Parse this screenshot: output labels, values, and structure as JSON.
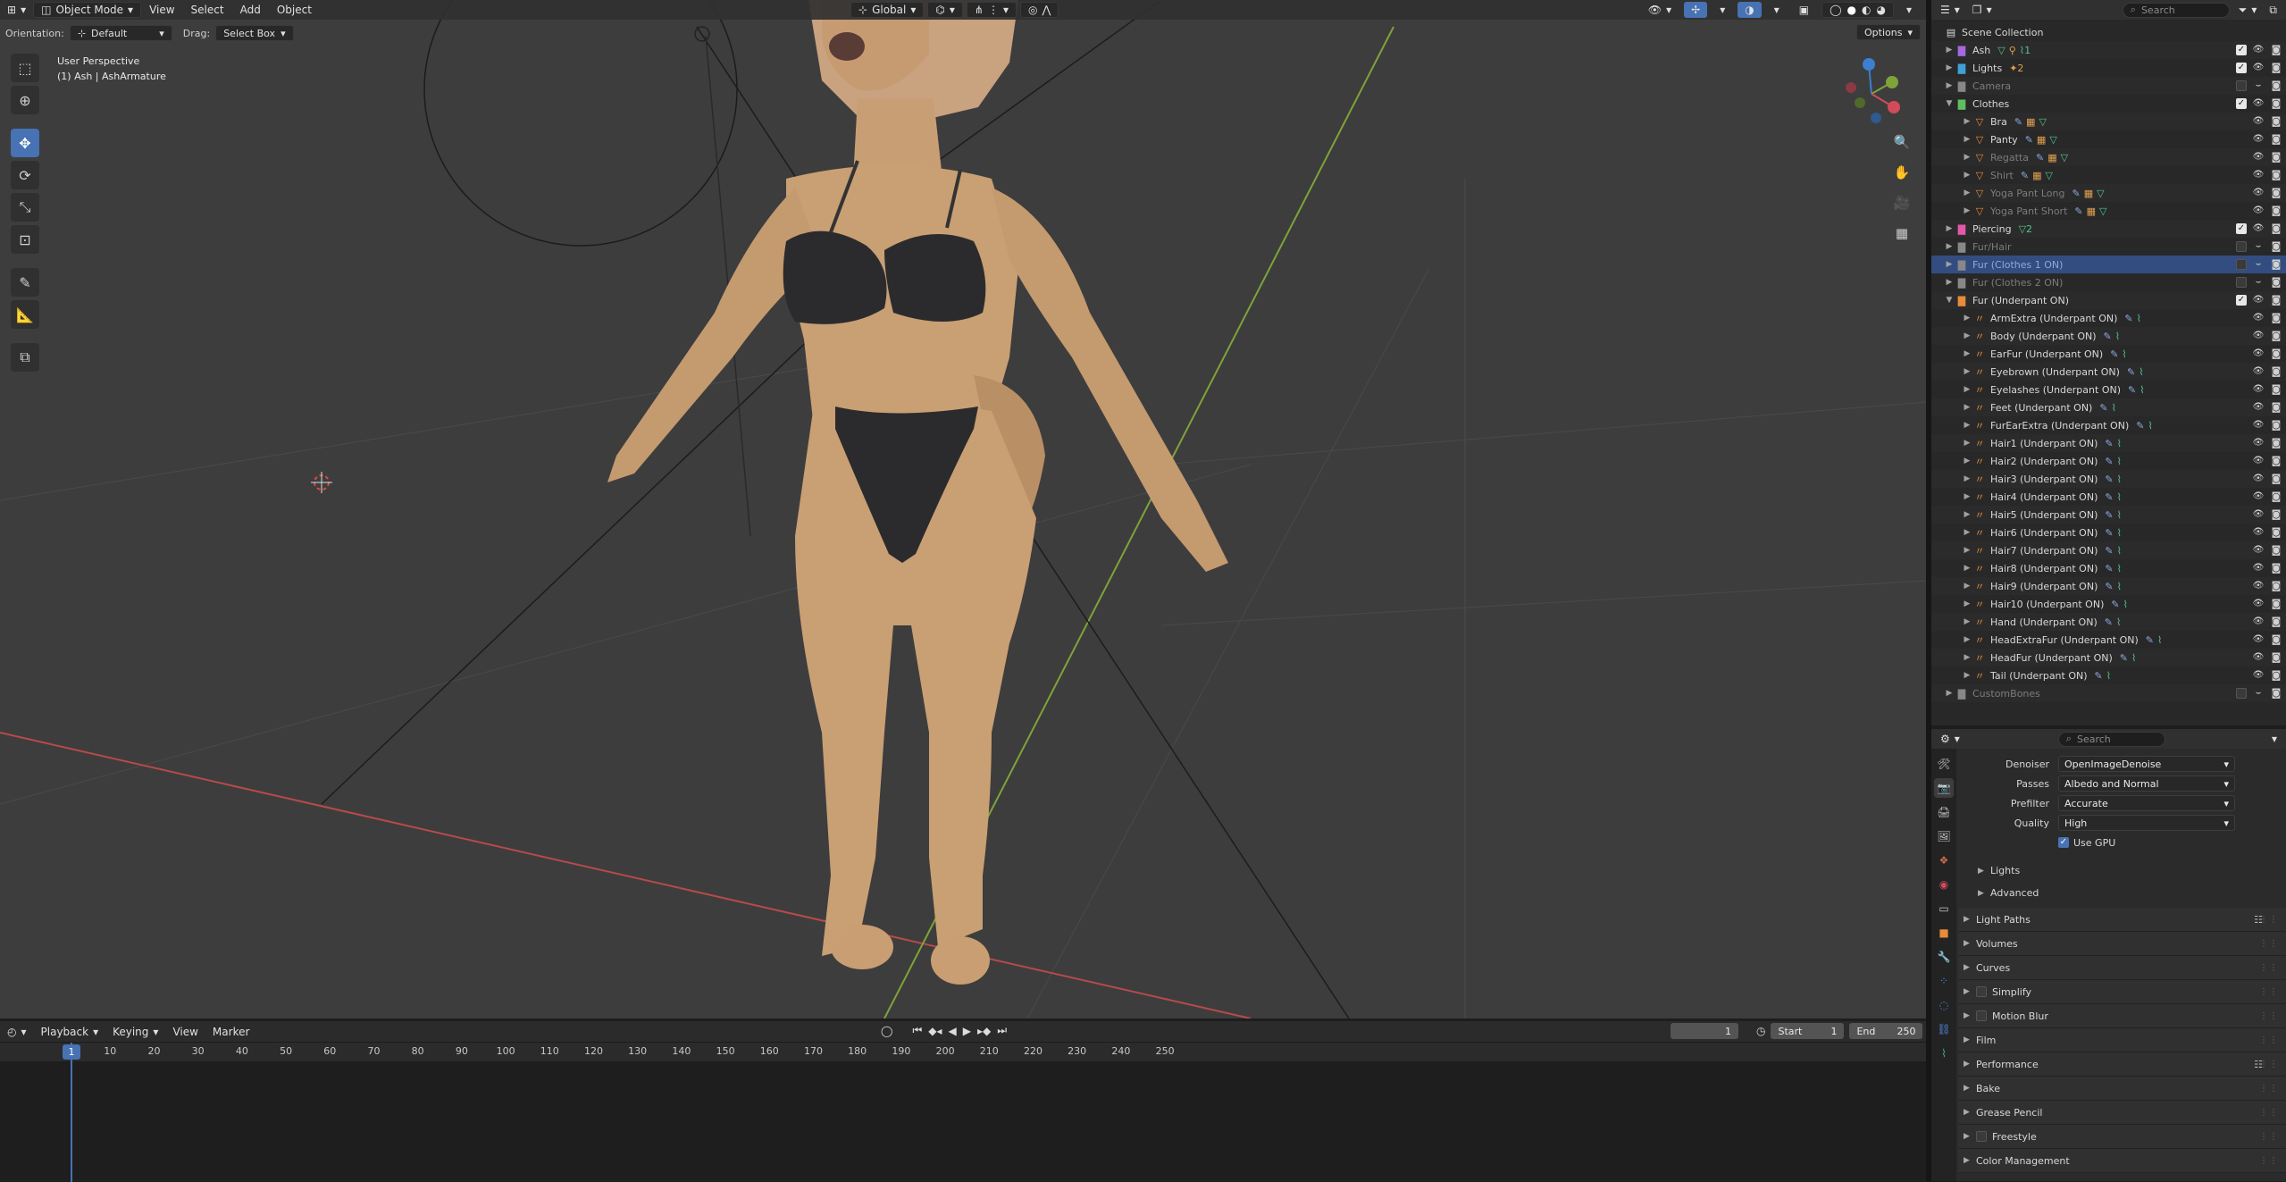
{
  "viewport": {
    "header": {
      "editor_icon": "view3d-icon",
      "mode": "Object Mode",
      "menus": [
        "View",
        "Select",
        "Add",
        "Object"
      ],
      "transform_orientation": "Global"
    },
    "tool_header": {
      "orientation_label": "Orientation:",
      "orientation_value": "Default",
      "drag_label": "Drag:",
      "drag_value": "Select Box",
      "options": "Options"
    },
    "overlay_text": {
      "line1": "User Perspective",
      "line2": "(1) Ash | AshArmature"
    },
    "toolbar_tools": [
      "select-box-icon",
      "cursor-icon",
      "move-icon",
      "rotate-icon",
      "scale-icon",
      "transform-icon",
      "annotate-icon",
      "measure-icon",
      "add-cube-icon"
    ],
    "active_tool": "move-icon"
  },
  "timeline": {
    "menus": [
      "Playback",
      "Keying",
      "View",
      "Marker"
    ],
    "current_frame": "1",
    "start_label": "Start",
    "start": "1",
    "end_label": "End",
    "end": "250",
    "ruler_ticks": [
      "1",
      "10",
      "20",
      "30",
      "40",
      "50",
      "60",
      "70",
      "80",
      "90",
      "100",
      "110",
      "120",
      "130",
      "140",
      "150",
      "160",
      "170",
      "180",
      "190",
      "200",
      "210",
      "220",
      "230",
      "240",
      "250"
    ],
    "playhead_label": "1"
  },
  "outliner": {
    "search_placeholder": "Search",
    "root": "Scene Collection",
    "rows": [
      {
        "label": "Ash",
        "level": 1,
        "kind": "collection",
        "color": "#a468e0",
        "expanded": false,
        "checked": true,
        "dim": false,
        "extra": [
          "▽",
          "⚲",
          "⌇1"
        ]
      },
      {
        "label": "Lights",
        "level": 1,
        "kind": "collection",
        "color": "#3fa0d8",
        "expanded": false,
        "checked": true,
        "dim": false,
        "extra": [
          "✦2"
        ]
      },
      {
        "label": "Camera",
        "level": 1,
        "kind": "collection",
        "color": "#888888",
        "expanded": false,
        "checked": false,
        "dim": true,
        "extra": []
      },
      {
        "label": "Clothes",
        "level": 1,
        "kind": "collection",
        "color": "#5fbf5f",
        "expanded": true,
        "checked": true,
        "dim": false,
        "extra": []
      },
      {
        "label": "Bra",
        "level": 2,
        "kind": "mesh",
        "color": "#e88b3a",
        "expanded": false,
        "checked": null,
        "dim": false,
        "extra": [
          "✎",
          "▦",
          "▽"
        ]
      },
      {
        "label": "Panty",
        "level": 2,
        "kind": "mesh",
        "color": "#e88b3a",
        "expanded": false,
        "checked": null,
        "dim": false,
        "extra": [
          "✎",
          "▦",
          "▽"
        ]
      },
      {
        "label": "Regatta",
        "level": 2,
        "kind": "mesh",
        "color": "#e88b3a",
        "expanded": false,
        "checked": null,
        "dim": true,
        "extra": [
          "✎",
          "▦",
          "▽"
        ]
      },
      {
        "label": "Shirt",
        "level": 2,
        "kind": "mesh",
        "color": "#e88b3a",
        "expanded": false,
        "checked": null,
        "dim": true,
        "extra": [
          "✎",
          "▦",
          "▽"
        ]
      },
      {
        "label": "Yoga Pant Long",
        "level": 2,
        "kind": "mesh",
        "color": "#e88b3a",
        "expanded": false,
        "checked": null,
        "dim": true,
        "extra": [
          "✎",
          "▦",
          "▽"
        ]
      },
      {
        "label": "Yoga Pant Short",
        "level": 2,
        "kind": "mesh",
        "color": "#e88b3a",
        "expanded": false,
        "checked": null,
        "dim": true,
        "extra": [
          "✎",
          "▦",
          "▽"
        ]
      },
      {
        "label": "Piercing",
        "level": 1,
        "kind": "collection",
        "color": "#e05aa8",
        "expanded": false,
        "checked": true,
        "dim": false,
        "extra": [
          "▽2"
        ]
      },
      {
        "label": "Fur/Hair",
        "level": 1,
        "kind": "collection",
        "color": "#888888",
        "expanded": false,
        "checked": false,
        "dim": true,
        "extra": []
      },
      {
        "label": "Fur (Clothes 1 ON)",
        "level": 1,
        "kind": "collection",
        "color": "#888888",
        "expanded": false,
        "checked": false,
        "dim": true,
        "selected": true,
        "extra": []
      },
      {
        "label": "Fur (Clothes 2 ON)",
        "level": 1,
        "kind": "collection",
        "color": "#888888",
        "expanded": false,
        "checked": false,
        "dim": true,
        "extra": []
      },
      {
        "label": "Fur (Underpant ON)",
        "level": 1,
        "kind": "collection",
        "color": "#e88b3a",
        "expanded": true,
        "checked": true,
        "dim": false,
        "extra": []
      },
      {
        "label": "ArmExtra (Underpant ON)",
        "level": 2,
        "kind": "curves",
        "color": "#e88b3a",
        "expanded": false,
        "checked": null,
        "dim": false,
        "extra": [
          "✎",
          "⌇"
        ]
      },
      {
        "label": "Body (Underpant ON)",
        "level": 2,
        "kind": "curves",
        "color": "#e88b3a",
        "expanded": false,
        "checked": null,
        "dim": false,
        "extra": [
          "✎",
          "⌇"
        ]
      },
      {
        "label": "EarFur (Underpant ON)",
        "level": 2,
        "kind": "curves",
        "color": "#e88b3a",
        "expanded": false,
        "checked": null,
        "dim": false,
        "extra": [
          "✎",
          "⌇"
        ]
      },
      {
        "label": "Eyebrown (Underpant ON)",
        "level": 2,
        "kind": "curves",
        "color": "#e88b3a",
        "expanded": false,
        "checked": null,
        "dim": false,
        "extra": [
          "✎",
          "⌇"
        ]
      },
      {
        "label": "Eyelashes (Underpant ON)",
        "level": 2,
        "kind": "curves",
        "color": "#e88b3a",
        "expanded": false,
        "checked": null,
        "dim": false,
        "extra": [
          "✎",
          "⌇"
        ]
      },
      {
        "label": "Feet (Underpant ON)",
        "level": 2,
        "kind": "curves",
        "color": "#e88b3a",
        "expanded": false,
        "checked": null,
        "dim": false,
        "extra": [
          "✎",
          "⌇"
        ]
      },
      {
        "label": "FurEarExtra (Underpant ON)",
        "level": 2,
        "kind": "curves",
        "color": "#e88b3a",
        "expanded": false,
        "checked": null,
        "dim": false,
        "extra": [
          "✎",
          "⌇"
        ]
      },
      {
        "label": "Hair1 (Underpant ON)",
        "level": 2,
        "kind": "curves",
        "color": "#e88b3a",
        "expanded": false,
        "checked": null,
        "dim": false,
        "extra": [
          "✎",
          "⌇"
        ]
      },
      {
        "label": "Hair2 (Underpant ON)",
        "level": 2,
        "kind": "curves",
        "color": "#e88b3a",
        "expanded": false,
        "checked": null,
        "dim": false,
        "extra": [
          "✎",
          "⌇"
        ]
      },
      {
        "label": "Hair3 (Underpant ON)",
        "level": 2,
        "kind": "curves",
        "color": "#e88b3a",
        "expanded": false,
        "checked": null,
        "dim": false,
        "extra": [
          "✎",
          "⌇"
        ]
      },
      {
        "label": "Hair4 (Underpant ON)",
        "level": 2,
        "kind": "curves",
        "color": "#e88b3a",
        "expanded": false,
        "checked": null,
        "dim": false,
        "extra": [
          "✎",
          "⌇"
        ]
      },
      {
        "label": "Hair5 (Underpant ON)",
        "level": 2,
        "kind": "curves",
        "color": "#e88b3a",
        "expanded": false,
        "checked": null,
        "dim": false,
        "extra": [
          "✎",
          "⌇"
        ]
      },
      {
        "label": "Hair6 (Underpant ON)",
        "level": 2,
        "kind": "curves",
        "color": "#e88b3a",
        "expanded": false,
        "checked": null,
        "dim": false,
        "extra": [
          "✎",
          "⌇"
        ]
      },
      {
        "label": "Hair7 (Underpant ON)",
        "level": 2,
        "kind": "curves",
        "color": "#e88b3a",
        "expanded": false,
        "checked": null,
        "dim": false,
        "extra": [
          "✎",
          "⌇"
        ]
      },
      {
        "label": "Hair8 (Underpant ON)",
        "level": 2,
        "kind": "curves",
        "color": "#e88b3a",
        "expanded": false,
        "checked": null,
        "dim": false,
        "extra": [
          "✎",
          "⌇"
        ]
      },
      {
        "label": "Hair9 (Underpant ON)",
        "level": 2,
        "kind": "curves",
        "color": "#e88b3a",
        "expanded": false,
        "checked": null,
        "dim": false,
        "extra": [
          "✎",
          "⌇"
        ]
      },
      {
        "label": "Hair10 (Underpant ON)",
        "level": 2,
        "kind": "curves",
        "color": "#e88b3a",
        "expanded": false,
        "checked": null,
        "dim": false,
        "extra": [
          "✎",
          "⌇"
        ]
      },
      {
        "label": "Hand (Underpant ON)",
        "level": 2,
        "kind": "curves",
        "color": "#e88b3a",
        "expanded": false,
        "checked": null,
        "dim": false,
        "extra": [
          "✎",
          "⌇"
        ]
      },
      {
        "label": "HeadExtraFur (Underpant ON)",
        "level": 2,
        "kind": "curves",
        "color": "#e88b3a",
        "expanded": false,
        "checked": null,
        "dim": false,
        "extra": [
          "✎",
          "⌇"
        ]
      },
      {
        "label": "HeadFur (Underpant ON)",
        "level": 2,
        "kind": "curves",
        "color": "#e88b3a",
        "expanded": false,
        "checked": null,
        "dim": false,
        "extra": [
          "✎",
          "⌇"
        ]
      },
      {
        "label": "Tail (Underpant ON)",
        "level": 2,
        "kind": "curves",
        "color": "#e88b3a",
        "expanded": false,
        "checked": null,
        "dim": false,
        "extra": [
          "✎",
          "⌇"
        ]
      },
      {
        "label": "CustomBones",
        "level": 1,
        "kind": "collection",
        "color": "#888888",
        "expanded": false,
        "checked": false,
        "dim": true,
        "extra": []
      }
    ]
  },
  "properties": {
    "search_placeholder": "Search",
    "tabs": [
      "tool-icon",
      "render-icon",
      "output-icon",
      "view-layer-icon",
      "scene-icon",
      "world-icon",
      "collection-icon",
      "object-icon",
      "modifier-icon",
      "particles-icon",
      "physics-icon",
      "constraints-icon",
      "data-icon"
    ],
    "active_tab": "render-icon",
    "denoise_fields": [
      {
        "label": "Denoiser",
        "value": "OpenImageDenoise"
      },
      {
        "label": "Passes",
        "value": "Albedo and Normal"
      },
      {
        "label": "Prefilter",
        "value": "Accurate"
      },
      {
        "label": "Quality",
        "value": "High"
      }
    ],
    "use_gpu": "Use GPU",
    "subpanels": [
      "Lights",
      "Advanced"
    ],
    "panels": [
      {
        "label": "Light Paths",
        "checkbox": false,
        "preset": true
      },
      {
        "label": "Volumes",
        "checkbox": false,
        "preset": false
      },
      {
        "label": "Curves",
        "checkbox": false,
        "preset": false
      },
      {
        "label": "Simplify",
        "checkbox": true,
        "preset": false
      },
      {
        "label": "Motion Blur",
        "checkbox": true,
        "preset": false
      },
      {
        "label": "Film",
        "checkbox": false,
        "preset": false
      },
      {
        "label": "Performance",
        "checkbox": false,
        "preset": true
      },
      {
        "label": "Bake",
        "checkbox": false,
        "preset": false
      },
      {
        "label": "Grease Pencil",
        "checkbox": false,
        "preset": false
      },
      {
        "label": "Freestyle",
        "checkbox": true,
        "preset": false
      },
      {
        "label": "Color Management",
        "checkbox": false,
        "preset": false
      }
    ]
  },
  "colors": {
    "accent": "#4772b3",
    "selection": "#334d80",
    "x_axis": "#b84a4a",
    "y_axis": "#7fa33b"
  }
}
